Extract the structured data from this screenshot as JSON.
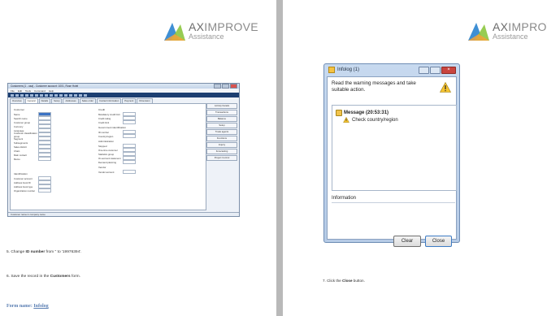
{
  "logo": {
    "brand_prefix": "AX",
    "brand_suffix": "IMPROVE",
    "tagline": "Assistance",
    "colors": {
      "blue": "#3f8fd4",
      "green": "#8cc63f",
      "gray": "#8a8a8a"
    }
  },
  "left_page": {
    "ax_form": {
      "window_title": "Customers (1 - usa) - Customer account: 1001, Rose Hotel",
      "menu": [
        "File",
        "Edit",
        "Tools",
        "Command",
        "Help"
      ],
      "tabs": [
        "Overview",
        "General",
        "Details",
        "Setup",
        "Addresses",
        "Sales order",
        "Contact information",
        "Payment",
        "Dimension"
      ],
      "active_tab": "General",
      "left_group_title": "Customer",
      "left_fields": [
        "Name",
        "Search name",
        "Customer group",
        "Currency",
        "Language",
        "Customer classification group",
        "Segment",
        "Subsegments",
        "Sales district",
        "Chain",
        "Main contact",
        "Memo"
      ],
      "identification_title": "Identification",
      "identification_fields": [
        "Customer account",
        "Address book ID",
        "Address book type",
        "Organization number"
      ],
      "credit_title": "Credit",
      "credit_fields": [
        "Mandatory credit limit",
        "Credit rating",
        "Credit limit"
      ],
      "gov_title": "Government identification",
      "gov_fields": [
        "ID number",
        "Country/region"
      ],
      "admin_title": "Administration",
      "admin_fields": [
        "Stopped",
        "One-time customer",
        "Statistics group",
        "On-account statement",
        "Demand planning"
      ],
      "vendor_title": "Vendor",
      "vendor_fields": [
        "Vendor account"
      ],
      "side_buttons": [
        "Activity Details",
        "Transactions",
        "Balance",
        "Setup",
        "Trade agents",
        "Functions",
        "Inquiry",
        "Forecasting",
        "Project Control"
      ],
      "status_text": "Customer name in company name"
    },
    "step5_prefix": "5. Change ",
    "step5_bold": "ID number",
    "step5_suffix": " from '' to '19976394'.",
    "step6_prefix": "6. Save the record in the ",
    "step6_bold": "Customers",
    "step6_suffix": " form.",
    "form_name_label": "Form name: ",
    "form_name_value": "Infolog"
  },
  "right_page": {
    "dialog": {
      "title": "Infolog (1)",
      "instruction": "Read the warning messages and take suitable action.",
      "message_label": "Message (20:53:31)",
      "warning_text": "Check country/region",
      "info_header": "Information",
      "clear_label": "Clear",
      "close_label": "Close"
    },
    "step7_prefix": "7. Click the ",
    "step7_bold": "Close",
    "step7_suffix": " button."
  }
}
